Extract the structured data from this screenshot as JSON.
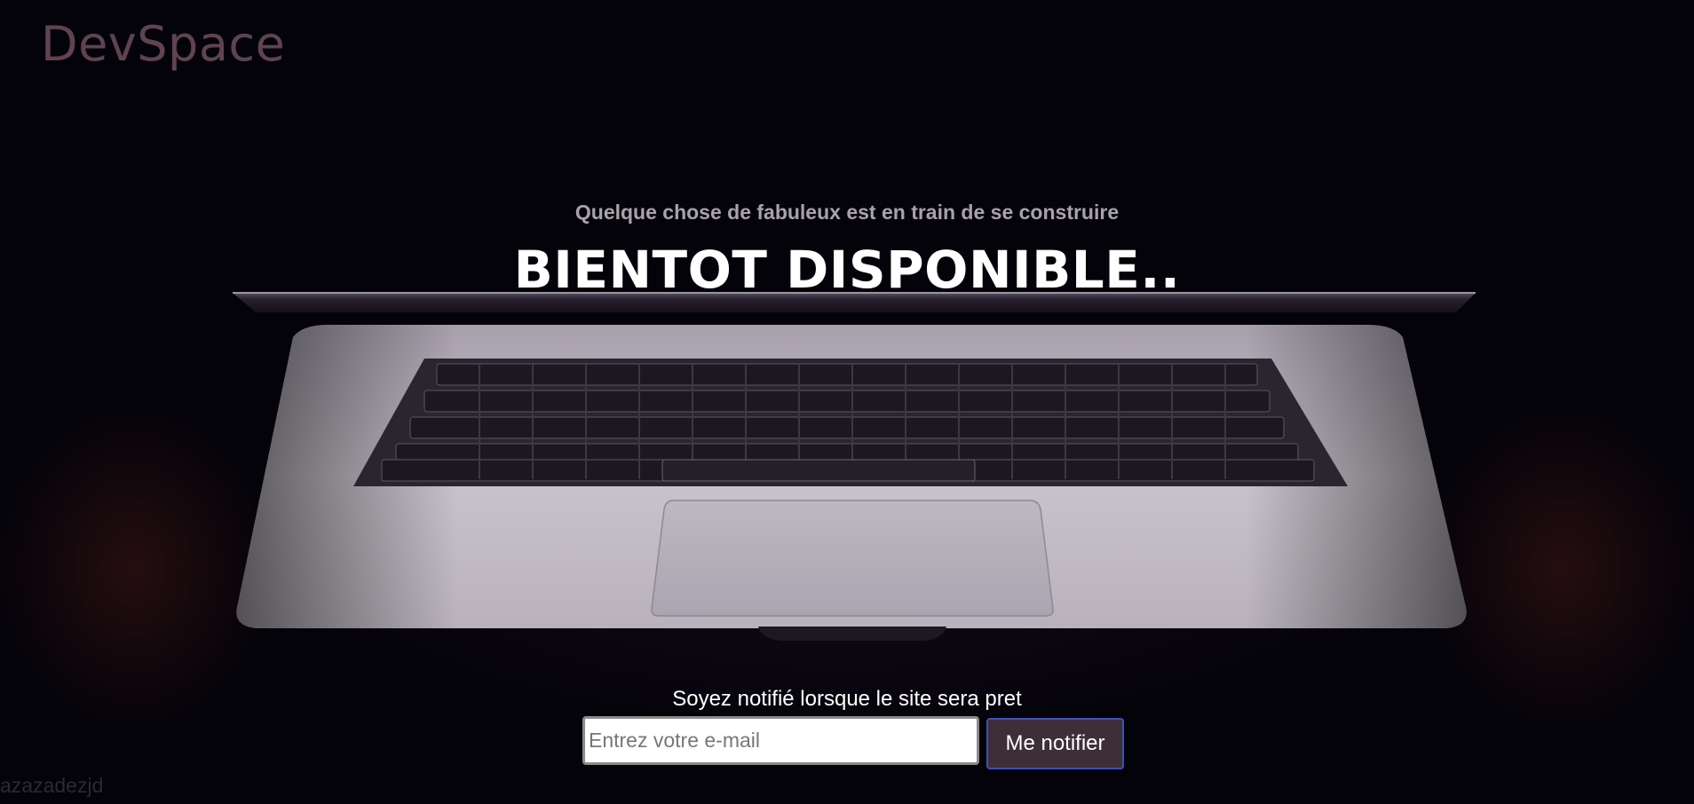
{
  "header": {
    "brand": "DevSpace"
  },
  "hero": {
    "tagline": "Quelque chose de fabuleux est en train de se construire",
    "headline": "BIENTOT DISPONIBLE.."
  },
  "notify": {
    "label": "Soyez notifié lorsque le site sera pret",
    "email_placeholder": "Entrez votre e-mail",
    "email_value": "",
    "button_label": "Me notifier"
  },
  "footer": {
    "text": "azazadezjd"
  },
  "colors": {
    "background": "#05030a",
    "brand": "#5e4450",
    "button_bg": "#3e2e37",
    "button_border": "#3a54b8"
  }
}
